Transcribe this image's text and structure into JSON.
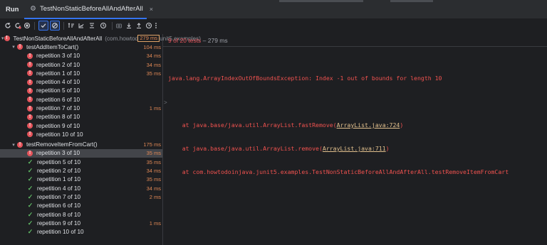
{
  "header": {
    "run_label": "Run",
    "tab_label": "TestNonStaticBeforeAllAndAfterAll",
    "tab_close": "×"
  },
  "toolbar": {
    "icons": [
      "rerun-icon",
      "stop-icon",
      "sort-icon",
      "collapse-icon",
      "show-passed-icon",
      "show-ignored-icon",
      "import-icon",
      "export-icon",
      "history-icon",
      "more-icon"
    ]
  },
  "tree": {
    "root": {
      "label": "TestNonStaticBeforeAllAndAfterAll",
      "pkg": "(com.howtodoinjava.junit5.examples)",
      "duration": "279 ms",
      "status": "fail"
    },
    "groups": [
      {
        "label": "testAddItemToCart()",
        "duration": "104 ms",
        "status": "fail",
        "items": [
          {
            "label": "repetition 3 of 10",
            "duration": "34 ms",
            "status": "fail"
          },
          {
            "label": "repetition 2 of 10",
            "duration": "34 ms",
            "status": "fail"
          },
          {
            "label": "repetition 1 of 10",
            "duration": "35 ms",
            "status": "fail"
          },
          {
            "label": "repetition 4 of 10",
            "duration": "",
            "status": "fail"
          },
          {
            "label": "repetition 5 of 10",
            "duration": "",
            "status": "fail"
          },
          {
            "label": "repetition 6 of 10",
            "duration": "",
            "status": "fail"
          },
          {
            "label": "repetition 7 of 10",
            "duration": "1 ms",
            "status": "fail"
          },
          {
            "label": "repetition 8 of 10",
            "duration": "",
            "status": "fail"
          },
          {
            "label": "repetition 9 of 10",
            "duration": "",
            "status": "fail"
          },
          {
            "label": "repetition 10 of 10",
            "duration": "",
            "status": "fail"
          }
        ]
      },
      {
        "label": "testRemoveItemFromCart()",
        "duration": "175 ms",
        "status": "fail",
        "items": [
          {
            "label": "repetition 3 of 10",
            "duration": "35 ms",
            "status": "fail",
            "selected": true
          },
          {
            "label": "repetition 5 of 10",
            "duration": "35 ms",
            "status": "pass"
          },
          {
            "label": "repetition 2 of 10",
            "duration": "34 ms",
            "status": "pass"
          },
          {
            "label": "repetition 1 of 10",
            "duration": "35 ms",
            "status": "pass"
          },
          {
            "label": "repetition 4 of 10",
            "duration": "34 ms",
            "status": "pass"
          },
          {
            "label": "repetition 7 of 10",
            "duration": "2 ms",
            "status": "pass"
          },
          {
            "label": "repetition 6 of 10",
            "duration": "",
            "status": "pass"
          },
          {
            "label": "repetition 8 of 10",
            "duration": "",
            "status": "pass"
          },
          {
            "label": "repetition 9 of 10",
            "duration": "1 ms",
            "status": "pass"
          },
          {
            "label": "repetition 10 of 10",
            "duration": "",
            "status": "pass"
          }
        ]
      }
    ]
  },
  "status_bar": {
    "count": "9 of 20 tests",
    "separator": " – ",
    "time": "279 ms"
  },
  "console": {
    "exception": "java.lang.ArrayIndexOutOfBoundsException: Index -1 out of bounds for length 10",
    "frames": [
      {
        "prefix": "    at java.base/java.util.ArrayList.fastRemove(",
        "link": "ArrayList.java:724",
        "suffix": ")"
      },
      {
        "prefix": "    at java.base/java.util.ArrayList.remove(",
        "link": "ArrayList.java:711",
        "suffix": ")"
      },
      {
        "prefix": "    at com.howtodoinjava.junit5.examples.TestNonStaticBeforeAllAndAfterAll.testRemoveItemFromCart",
        "link": "",
        "suffix": ""
      }
    ],
    "fold_marker": ">"
  },
  "colors": {
    "accent": "#3574f0",
    "error": "#e5545b",
    "pass": "#5fb865",
    "duration": "#e08855"
  }
}
